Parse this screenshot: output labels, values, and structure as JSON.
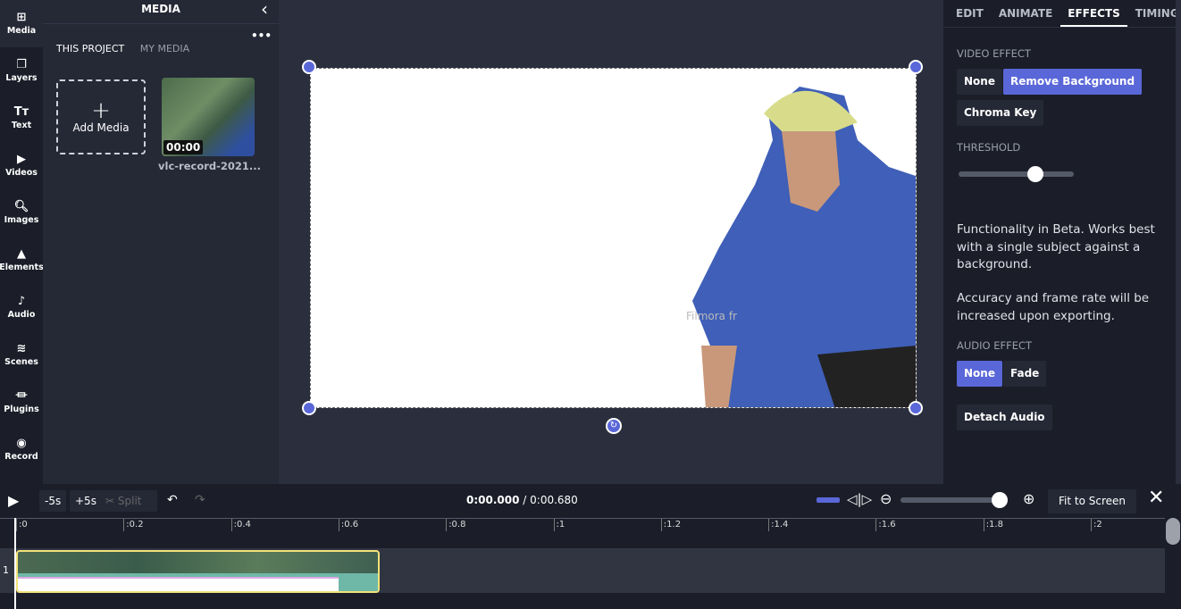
{
  "rail": [
    {
      "label": "Media",
      "icon": "media-plus-icon"
    },
    {
      "label": "Layers",
      "icon": "layers-icon"
    },
    {
      "label": "Text",
      "icon": "text-icon"
    },
    {
      "label": "Videos",
      "icon": "video-icon"
    },
    {
      "label": "Images",
      "icon": "search-icon"
    },
    {
      "label": "Elements",
      "icon": "shapes-icon"
    },
    {
      "label": "Audio",
      "icon": "music-note-icon"
    },
    {
      "label": "Scenes",
      "icon": "stack-icon"
    },
    {
      "label": "Plugins",
      "icon": "plug-icon"
    },
    {
      "label": "Record",
      "icon": "record-icon"
    }
  ],
  "media": {
    "title": "MEDIA",
    "tabs": [
      "THIS PROJECT",
      "MY MEDIA"
    ],
    "add_label": "Add Media",
    "item": {
      "duration": "00:00",
      "name": "vlc-record-2021..."
    }
  },
  "canvas": {
    "watermark": "Filmora fr"
  },
  "right": {
    "tabs": [
      "EDIT",
      "ANIMATE",
      "EFFECTS",
      "TIMING"
    ],
    "active_tab": "EFFECTS",
    "video_effect_label": "VIDEO EFFECT",
    "video_effects": [
      "None",
      "Remove Background",
      "Chroma Key"
    ],
    "video_effect_selected": "Remove Background",
    "threshold_label": "THRESHOLD",
    "threshold_percent": 67,
    "note1": "Functionality in Beta. Works best with a single subject against a background.",
    "note2": "Accuracy and frame rate will be increased upon exporting.",
    "audio_effect_label": "AUDIO EFFECT",
    "audio_effects": [
      "None",
      "Fade"
    ],
    "audio_effect_selected": "None",
    "detach_label": "Detach Audio",
    "accent": "#5a67d8"
  },
  "timeline": {
    "back5": "-5s",
    "fwd5": "+5s",
    "split": "Split",
    "current": "0:00.000",
    "total": "/ 0:00.680",
    "fit": "Fit to Screen",
    "zoom_percent": 100,
    "ticks": [
      ":0",
      ":0.2",
      ":0.4",
      ":0.6",
      ":0.8",
      ":1",
      ":1.2",
      ":1.4",
      ":1.6",
      ":1.8",
      ":2"
    ],
    "track_number": "1"
  }
}
